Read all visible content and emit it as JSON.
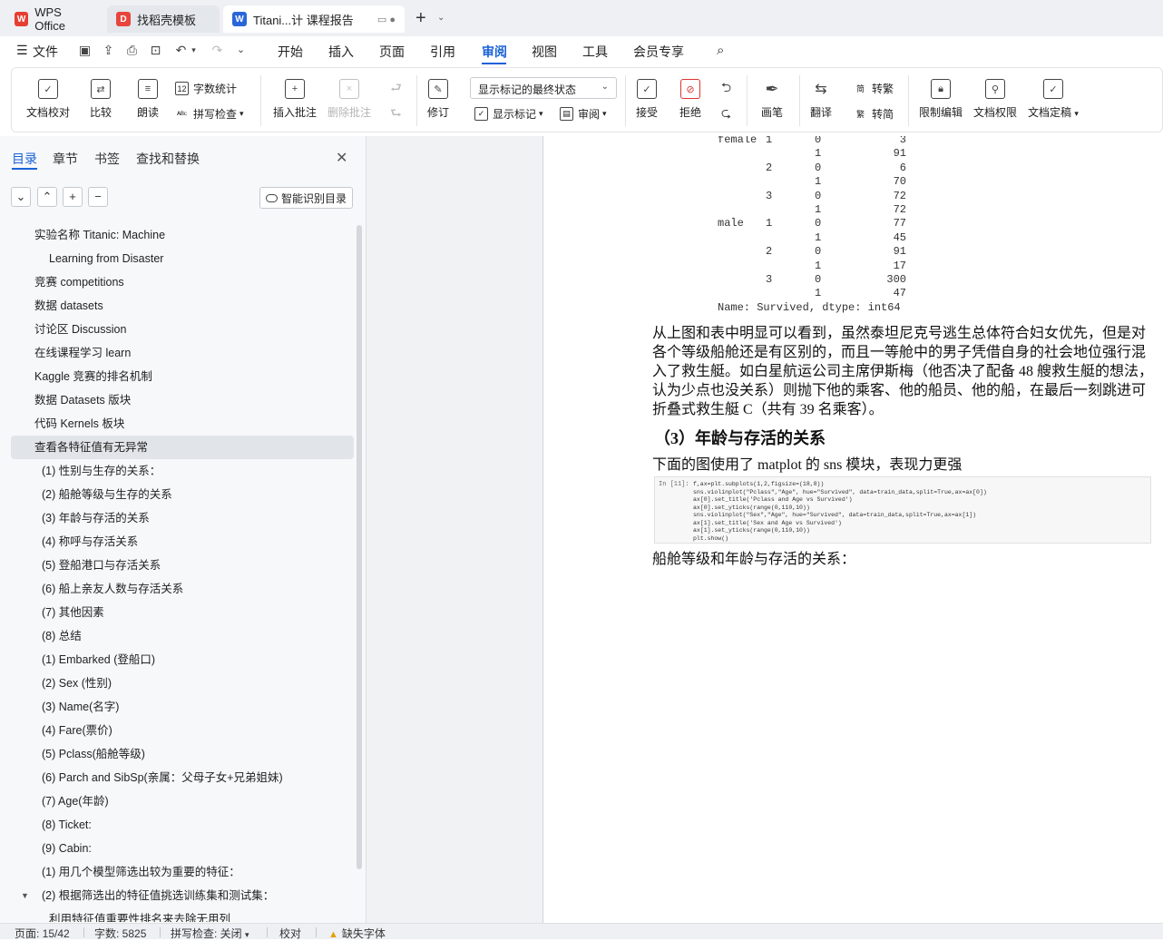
{
  "tabs": [
    {
      "label": "WPS Office",
      "icon": "wps-logo-icon"
    },
    {
      "label": "找稻壳模板",
      "icon": "docer-icon"
    },
    {
      "label": "Titani...计 课程报告",
      "icon": "writer-doc-icon"
    }
  ],
  "menu": {
    "file": "文件",
    "items": [
      "开始",
      "插入",
      "页面",
      "引用",
      "审阅",
      "视图",
      "工具",
      "会员专享"
    ],
    "active": "审阅"
  },
  "ribbon": {
    "proofread": "文档校对",
    "compare": "比较",
    "read_aloud": "朗读",
    "word_count": "字数统计",
    "spell_check": "拼写检查",
    "insert_comment": "插入批注",
    "delete_comment": "删除批注",
    "track_changes": "修订",
    "markup_state": "显示标记的最终状态",
    "show_markup": "显示标记",
    "review_pane": "审阅",
    "accept": "接受",
    "reject": "拒绝",
    "pen": "画笔",
    "translate": "翻译",
    "to_traditional": "转繁",
    "to_simplified": "转简",
    "restrict_edit": "限制编辑",
    "doc_permission": "文档权限",
    "doc_finalize": "文档定稿"
  },
  "sidebar": {
    "tabs": [
      "目录",
      "章节",
      "书签",
      "查找和替换"
    ],
    "smart_toc": "智能识别目录",
    "items": [
      {
        "label": "实验名称    Titanic: Machine",
        "indent": 1
      },
      {
        "label": "Learning  from Disaster",
        "indent": 3
      },
      {
        "label": "竞赛 competitions",
        "indent": 1
      },
      {
        "label": "数据 datasets",
        "indent": 1
      },
      {
        "label": "讨论区  Discussion",
        "indent": 1
      },
      {
        "label": "在线课程学习 learn",
        "indent": 1
      },
      {
        "label": "Kaggle 竞赛的排名机制",
        "indent": 1
      },
      {
        "label": "数据 Datasets 版块",
        "indent": 1
      },
      {
        "label": "代码 Kernels 板块",
        "indent": 1
      },
      {
        "label": "查看各特征值有无异常",
        "indent": 1,
        "selected": true
      },
      {
        "label": "(1) 性别与生存的关系：",
        "indent": 2
      },
      {
        "label": "(2) 船舱等级与生存的关系",
        "indent": 2
      },
      {
        "label": "(3) 年龄与存活的关系",
        "indent": 2
      },
      {
        "label": "(4) 称呼与存活关系",
        "indent": 2
      },
      {
        "label": "(5) 登船港口与存活关系",
        "indent": 2
      },
      {
        "label": "(6) 船上亲友人数与存活关系",
        "indent": 2
      },
      {
        "label": "(7) 其他因素",
        "indent": 2
      },
      {
        "label": "(8) 总结",
        "indent": 2
      },
      {
        "label": "(1) Embarked (登船口)",
        "indent": 2
      },
      {
        "label": "(2) Sex (性别)",
        "indent": 2
      },
      {
        "label": "(3) Name(名字)",
        "indent": 2
      },
      {
        "label": "(4) Fare(票价)",
        "indent": 2
      },
      {
        "label": "(5) Pclass(船舱等级)",
        "indent": 2
      },
      {
        "label": "(6) Parch and SibSp(亲属：父母子女+兄弟姐妹)",
        "indent": 2
      },
      {
        "label": "(7) Age(年龄)",
        "indent": 2
      },
      {
        "label": "(8) Ticket:",
        "indent": 2
      },
      {
        "label": "(9) Cabin:",
        "indent": 2
      },
      {
        "label": "(1) 用几个模型筛选出较为重要的特征：",
        "indent": 2
      },
      {
        "label": "(2) 根据筛选出的特征值挑选训练集和测试集：",
        "indent": 2,
        "expanded": true
      },
      {
        "label": "利用特征值重要性排名来去除无用列",
        "indent": 3
      }
    ]
  },
  "document": {
    "table_rows": [
      {
        "sex": "female",
        "pclass": "1",
        "survived": "0",
        "count": "3"
      },
      {
        "sex": "",
        "pclass": "",
        "survived": "1",
        "count": "91"
      },
      {
        "sex": "",
        "pclass": "2",
        "survived": "0",
        "count": "6"
      },
      {
        "sex": "",
        "pclass": "",
        "survived": "1",
        "count": "70"
      },
      {
        "sex": "",
        "pclass": "3",
        "survived": "0",
        "count": "72"
      },
      {
        "sex": "",
        "pclass": "",
        "survived": "1",
        "count": "72"
      },
      {
        "sex": "male",
        "pclass": "1",
        "survived": "0",
        "count": "77"
      },
      {
        "sex": "",
        "pclass": "",
        "survived": "1",
        "count": "45"
      },
      {
        "sex": "",
        "pclass": "2",
        "survived": "0",
        "count": "91"
      },
      {
        "sex": "",
        "pclass": "",
        "survived": "1",
        "count": "17"
      },
      {
        "sex": "",
        "pclass": "3",
        "survived": "0",
        "count": "300"
      },
      {
        "sex": "",
        "pclass": "",
        "survived": "1",
        "count": "47"
      }
    ],
    "series_footer": "Name: Survived, dtype: int64",
    "paragraph1": "从上图和表中明显可以看到，虽然泰坦尼克号逃生总体符合妇女优先，但是对各个等级船舱还是有区别的，而且一等舱中的男子凭借自身的社会地位强行混入了救生艇。如白星航运公司主席伊斯梅（他否决了配备 48 艘救生艇的想法，认为少点也没关系）则抛下他的乘客、他的船员、他的船，在最后一刻跳进可折叠式救生艇 C（共有 39 名乘客）。",
    "heading": "（3）年龄与存活的关系",
    "paragraph2": "下面的图使用了 matplot 的 sns 模块，表现力更强",
    "code_prompt": "In  [11]:",
    "code_lines": [
      "f,ax=plt.subplots(1,2,figsize=(18,8))",
      "sns.violinplot(\"Pclass\",\"Age\", hue=\"Survived\", data=train_data,split=True,ax=ax[0])",
      "ax[0].set_title('Pclass and Age vs Survived')",
      "ax[0].set_yticks(range(0,110,10))",
      "sns.violinplot(\"Sex\",\"Age\", hue=\"Survived\", data=train_data,split=True,ax=ax[1])",
      "ax[1].set_title('Sex and Age vs Survived')",
      "ax[1].set_yticks(range(0,110,10))",
      "plt.show()"
    ],
    "paragraph3": "船舱等级和年龄与存活的关系："
  },
  "statusbar": {
    "page": "页面: 15/42",
    "word_count": "字数: 5825",
    "spell_check": "拼写检查: 关闭",
    "proofread": "校对",
    "missing_font": "缺失字体"
  },
  "colors": {
    "accent": "#1a62d6",
    "wps_red": "#e63e30",
    "docer_red": "#e8453c",
    "writer_blue": "#2b66d9"
  }
}
